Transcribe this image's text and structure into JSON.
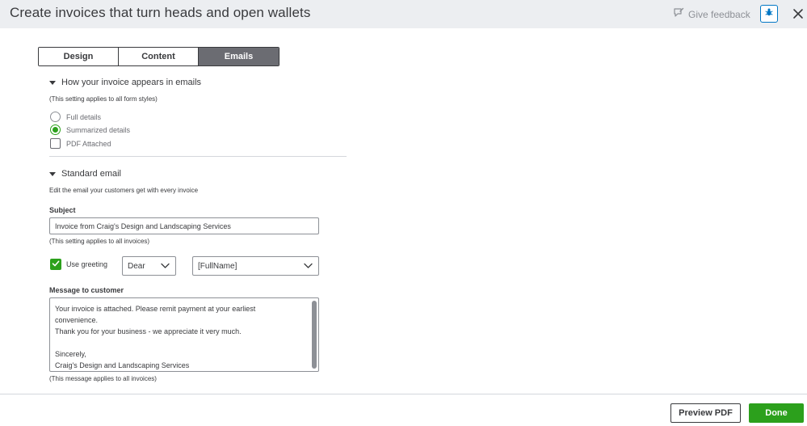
{
  "header": {
    "title": "Create invoices that turn heads and open wallets",
    "feedback_label": "Give feedback"
  },
  "tabs": [
    {
      "label": "Design",
      "active": false
    },
    {
      "label": "Content",
      "active": false
    },
    {
      "label": "Emails",
      "active": true
    }
  ],
  "appearance": {
    "heading": "How your invoice appears in emails",
    "note": "(This setting applies to all form styles)",
    "options": {
      "full": "Full details",
      "summarized": "Summarized details",
      "pdf": "PDF Attached"
    },
    "selected": "summarized",
    "pdf_attached": false
  },
  "standard_email": {
    "heading": "Standard email",
    "description": "Edit the email your customers get with every invoice",
    "subject_label": "Subject",
    "subject_value": "Invoice from Craig's Design and Landscaping Services",
    "subject_note": "(This setting applies to all invoices)",
    "greeting_label": "Use greeting",
    "greeting_enabled": true,
    "greeting_word": "Dear",
    "greeting_name": "[FullName]",
    "message_label": "Message to customer",
    "message_lines": [
      "Your invoice is attached.  Please remit payment at your earliest",
      "convenience.",
      "Thank you for your business - we appreciate it very much.",
      "",
      "Sincerely,",
      "Craig's Design and Landscaping Services"
    ],
    "message_note": "(This message applies to all invoices)"
  },
  "footer": {
    "preview_label": "Preview PDF",
    "done_label": "Done"
  },
  "colors": {
    "accent_green": "#2ca01c",
    "active_tab": "#6b6c72",
    "header_bg": "#eceef1",
    "bug_border": "#0077c5"
  }
}
